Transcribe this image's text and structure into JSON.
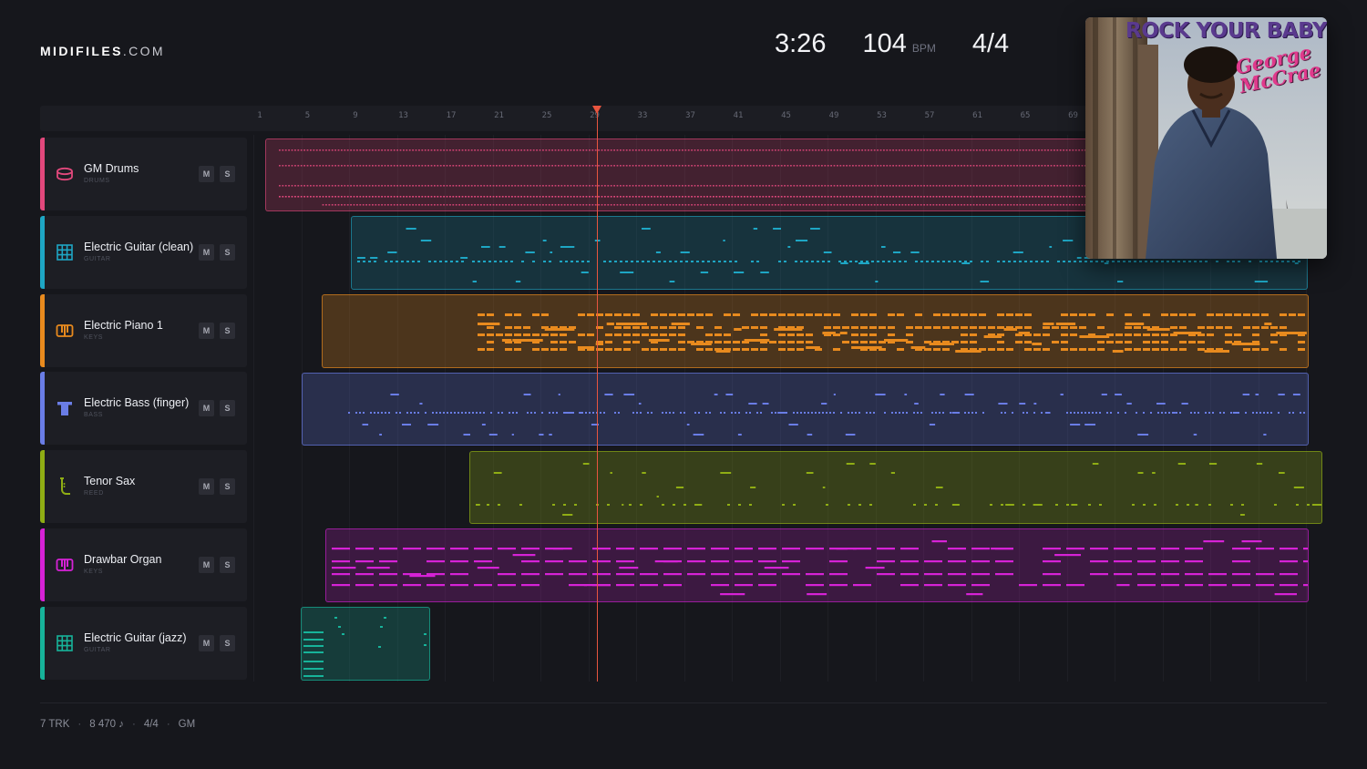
{
  "brand": {
    "name_bold": "MIDIFILES",
    "name_suffix": ".COM"
  },
  "stats": {
    "duration": "3:26",
    "tempo": "104",
    "tempo_unit": "BPM",
    "time_signature": "4/4"
  },
  "ruler": {
    "bars": [
      "1",
      "5",
      "9",
      "13",
      "17",
      "21",
      "25",
      "29",
      "33",
      "37",
      "41",
      "45",
      "49",
      "53",
      "57",
      "61",
      "65",
      "69"
    ]
  },
  "tracks": [
    {
      "name": "GM Drums",
      "category": "DRUMS",
      "color": "#e2487c",
      "icon": "drum-icon",
      "mute_label": "M",
      "solo_label": "S"
    },
    {
      "name": "Electric Guitar (clean)",
      "category": "GUITAR",
      "color": "#1ea6c4",
      "icon": "guitar-fretboard-icon",
      "mute_label": "M",
      "solo_label": "S"
    },
    {
      "name": "Electric Piano 1",
      "category": "KEYS",
      "color": "#e88a1e",
      "icon": "piano-keys-icon",
      "mute_label": "M",
      "solo_label": "S"
    },
    {
      "name": "Electric Bass (finger)",
      "category": "BASS",
      "color": "#6a7de6",
      "icon": "bass-icon",
      "mute_label": "M",
      "solo_label": "S"
    },
    {
      "name": "Tenor Sax",
      "category": "REED",
      "color": "#8fad14",
      "icon": "saxophone-icon",
      "mute_label": "M",
      "solo_label": "S"
    },
    {
      "name": "Drawbar Organ",
      "category": "KEYS",
      "color": "#d622d6",
      "icon": "organ-keys-icon",
      "mute_label": "M",
      "solo_label": "S"
    },
    {
      "name": "Electric Guitar (jazz)",
      "category": "GUITAR",
      "color": "#17b39a",
      "icon": "guitar-fretboard-icon",
      "mute_label": "M",
      "solo_label": "S"
    }
  ],
  "album": {
    "title": "ROCK YOUR BABY",
    "artist": "George McCrae"
  },
  "footer": {
    "tracks": "7 TRK",
    "notes": "8 470 ♪",
    "time_signature": "4/4",
    "standard": "GM"
  }
}
